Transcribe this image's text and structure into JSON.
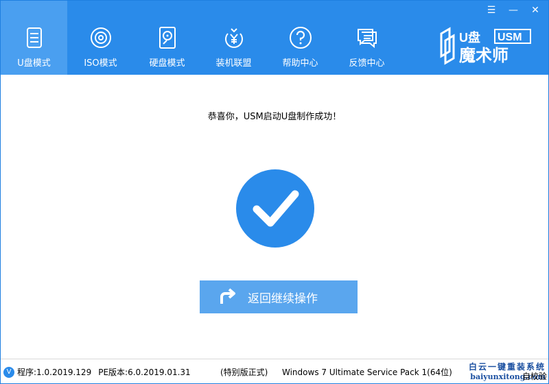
{
  "window": {
    "controls": {
      "menu": "☰",
      "minimize": "—",
      "close": "✕"
    }
  },
  "tabs": [
    {
      "label": "U盘模式",
      "icon": "usb-drive-icon",
      "active": true
    },
    {
      "label": "ISO模式",
      "icon": "disc-icon",
      "active": false
    },
    {
      "label": "硬盘模式",
      "icon": "hard-disk-icon",
      "active": false
    },
    {
      "label": "装机联盟",
      "icon": "yuan-coin-icon",
      "active": false
    },
    {
      "label": "帮助中心",
      "icon": "help-icon",
      "active": false
    },
    {
      "label": "反馈中心",
      "icon": "chat-icon",
      "active": false
    }
  ],
  "brand": {
    "logo_text_top": "U盘",
    "logo_badge": "USM",
    "logo_text_bottom": "魔术师"
  },
  "main": {
    "success_message": "恭喜你，USM启动U盘制作成功！",
    "return_button_label": "返回继续操作"
  },
  "statusbar": {
    "logo_letter": "V",
    "program_version": "程序:1.0.2019.129",
    "pe_version": "PE版本:6.0.2019.01.31",
    "edition": "(特别版正式)",
    "os_info": "Windows 7 Ultimate Service Pack 1(64位)",
    "self_check": "自校验",
    "watermark_cn": "白云一键重装系统",
    "watermark_url": "baiyunxitong.com"
  },
  "colors": {
    "header_blue": "#2a8bea",
    "active_tab": "#4a9ff0",
    "button": "#5aa6ee"
  }
}
